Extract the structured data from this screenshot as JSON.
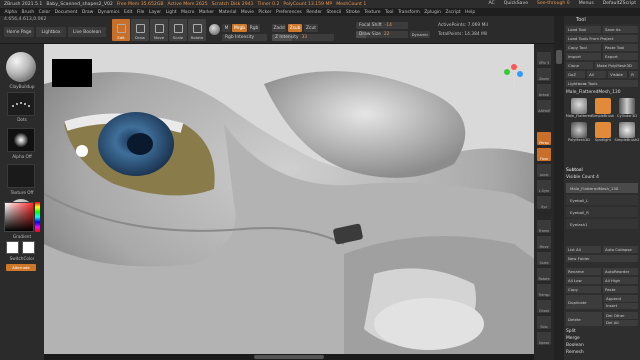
{
  "title_bar": {
    "app": "ZBrush 2021.5.1",
    "file": "Baby_Scanned_shapes2_V02",
    "free_mem": "Free Mem 35.652GB",
    "active_mem": "Active Mem 2625",
    "scratch": "Scratch Disk 2941",
    "timer": "Timer 0.2",
    "polycount": "PolyCount 13.159 MP",
    "mesh_count": "MeshCount 1",
    "ac": "AC",
    "quicksave": "QuickSave",
    "see_through": "See-through 0",
    "menus_label": "Menus",
    "ui": "DefaultZScript"
  },
  "menubar": [
    "Alpha",
    "Brush",
    "Color",
    "Document",
    "Draw",
    "Dynamics",
    "Edit",
    "File",
    "Layer",
    "Light",
    "Macro",
    "Marker",
    "Material",
    "Movie",
    "Picker",
    "Preferences",
    "Render",
    "Stencil",
    "Stroke",
    "Texture",
    "Tool",
    "Transform",
    "Zplugin",
    "Zscript",
    "Help"
  ],
  "toolbar": {
    "stats": "4.656,4.613,0.062",
    "home_page": "Home Page",
    "lightbox": "Lightbox",
    "live_boolean": "Live Boolean",
    "edit": "Edit",
    "draw": "Draw",
    "move": "Move",
    "scale": "Scale",
    "rotate": "Rotate",
    "m": "M",
    "mrgb": "Mrgb",
    "rgb": "Rgb",
    "zadd": "Zadd",
    "zsub": "Zsub",
    "zcut": "Zcut",
    "rgb_intensity_label": "Rgb Intensity",
    "z_intensity_label": "Z Intensity",
    "z_intensity_value": "33",
    "focal_shift_label": "Focal Shift",
    "focal_shift_value": "-14",
    "draw_size_label": "Draw Size",
    "draw_size_value": "22",
    "dynamic": "Dynamic",
    "active_points": "ActivePoints: 7.069 Mil",
    "total_points": "TotalPoints: 14.384 Mil"
  },
  "left_shelf": {
    "brush_name": "ClayBuildup",
    "stroke_name": "Dots",
    "alpha_name": "Alpha Off",
    "texture_name": "Texture Off",
    "material_name": "SkinShade4",
    "gradient": "Gradient",
    "switch_color": "SwitchColor",
    "alternate": "Alternate"
  },
  "right_icons": [
    "SPix 3",
    "Zoom",
    "Actual",
    "AAHalf",
    "Persp",
    "Floor",
    "Local",
    "L.Sym",
    "Xyz",
    "Frame",
    "Move",
    "Scale",
    "Rotate",
    "Transp",
    "Ghost",
    "Solo",
    "Xpose"
  ],
  "tool_palette": {
    "title": "Tool",
    "load_tool": "Load Tool",
    "save_as": "Save As",
    "load_from_project": "Load Tools From Project",
    "copy_tool": "Copy Tool",
    "paste_tool": "Paste Tool",
    "import": "Import",
    "export": "Export",
    "clone": "Clone",
    "make_polymesh": "Make PolyMesh3D",
    "goz": "GoZ",
    "all": "All",
    "visible": "Visible",
    "r": "R",
    "lightbox_tools": "Lightbox▸ Tools",
    "current_tool": "Male_FlatteredMesh_130",
    "thumbs": [
      "Male_Flattered",
      "SimpleBrush",
      "Cylinder3D",
      "PolyMesh3D",
      "Spotlight",
      "SimpleBrush2"
    ],
    "subtool": "Subtool",
    "visible_count": "Visible Count 4",
    "subtools": [
      "Male_FlatteredMesh_130",
      "Eyeball_L",
      "Eyeball_R",
      "Eyelash1"
    ],
    "list_all": "List All",
    "auto_collapse": "Auto Collapse",
    "new_folder": "New Folder",
    "rename": "Rename",
    "autoreorder": "AutoReorder",
    "all_low": "All Low",
    "all_high": "All High",
    "copy": "Copy",
    "paste": "Paste",
    "duplicate": "Duplicate",
    "append": "Append",
    "insert": "Insert",
    "delete": "Delete",
    "del_other": "Del Other",
    "del_all": "Del All",
    "split": "Split",
    "merge": "Merge",
    "boolean": "Boolean",
    "remesh": "Remesh"
  },
  "colors": {
    "accent_orange": "#d0782a",
    "panel_bg": "#2b2b2b",
    "viewport_bg": "#6a6a6a",
    "iris_blue": "#3f6f9a"
  }
}
